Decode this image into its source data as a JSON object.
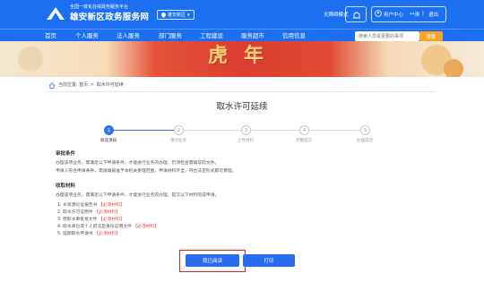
{
  "header": {
    "subtitle": "全国一体化在线政务服务平台",
    "title": "雄安新区政务服务网",
    "region": "雄安新区",
    "accessibility": "无障碍模式",
    "user_center": "用户中心",
    "user_name": "**涛",
    "logout": "退出"
  },
  "nav": {
    "items": [
      "首页",
      "个人服务",
      "法人服务",
      "部门服务",
      "工程建设",
      "服务超市",
      "信用信息"
    ],
    "search_placeholder": "搜索人员变更要的事项",
    "search_button": "搜索"
  },
  "banner": {
    "chars": [
      "虎",
      "年"
    ]
  },
  "breadcrumb": {
    "current_label": "当前位置:",
    "home": "首页",
    "page": "取水许可延续"
  },
  "page_title": "取水许可延续",
  "steps": {
    "current": 1,
    "items": [
      {
        "number": "1",
        "label": "阅读须知"
      },
      {
        "number": "2",
        "label": "填写业务"
      },
      {
        "number": "3",
        "label": "上传材料"
      },
      {
        "number": "4",
        "label": "完整提交"
      },
      {
        "number": "5",
        "label": "办理成功"
      }
    ]
  },
  "conditions": {
    "title": "审批条件",
    "lines": [
      "办理该项业务，需满足以下申请条件，才能进行业务的办理，仍须检查需填写的文件。",
      "申请人符合申请条件，需请填报准予本机关受理范围，申请材料齐全，符合法定形式即可受理。"
    ]
  },
  "materials": {
    "title": "收取材料",
    "intro": "办理该项业务，需满足以下申请条件，才能进行业务的办理，提交以下材料完成申请。",
    "items": [
      {
        "text": "1. 水资源论证报告书",
        "tag": "【必须材料】"
      },
      {
        "text": "2. 取水许可证原件",
        "tag": "【必须材料】"
      },
      {
        "text": "3. 原取水审批批文件",
        "tag": "【必须材料】"
      },
      {
        "text": "4. 取水单位或个人的法定身份证明文件",
        "tag": "【必须材料】"
      },
      {
        "text": "5. 延期取水申请书",
        "tag": "【必须材料】"
      }
    ]
  },
  "actions": {
    "read_done": "我已阅读",
    "print": "打印"
  },
  "colors": {
    "primary": "#1d6ff2",
    "button": "#2a6cf0",
    "search_button": "#f6a623",
    "highlight": "#e02020",
    "required": "#e2483d"
  }
}
